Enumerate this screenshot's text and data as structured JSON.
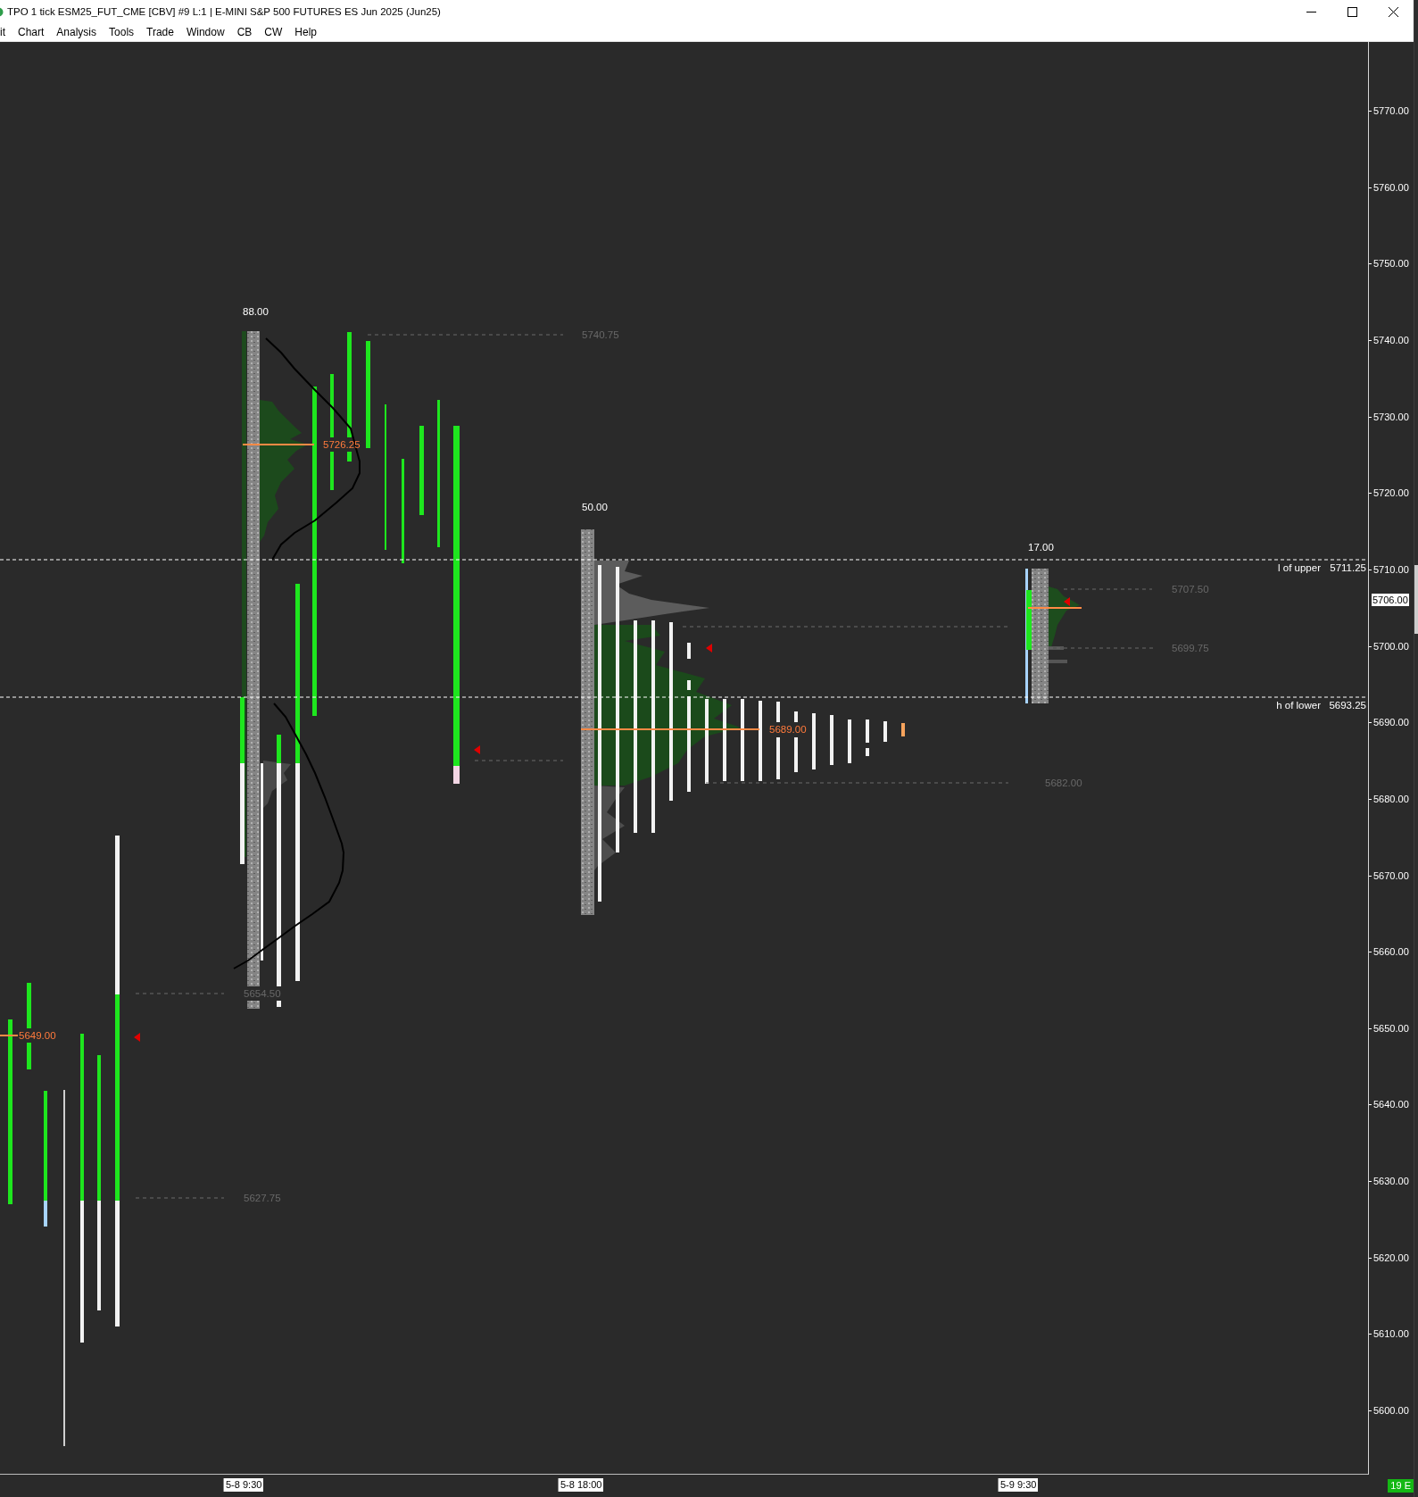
{
  "window": {
    "title": "TPO 1 tick ESM25_FUT_CME [CBV] #9 L:1 | E-MINI S&P 500 FUTURES ES Jun 2025 (Jun25)"
  },
  "menu": [
    "it",
    "Chart",
    "Analysis",
    "Tools",
    "Trade",
    "Window",
    "CB",
    "CW",
    "Help"
  ],
  "chart": {
    "sessions": [
      {
        "poc_label": "5649.00",
        "level_labels": [
          "5654.50",
          "5627.75"
        ]
      },
      {
        "range_label": "88.00",
        "poc_label": "5726.25",
        "level_labels": [
          "5740.75"
        ]
      },
      {
        "range_label": "50.00",
        "poc_label": "5689.00",
        "level_labels": [
          "5682.00"
        ]
      },
      {
        "range_label": "17.00",
        "level_labels": [
          "5707.50",
          "5699.75"
        ]
      }
    ],
    "range_lines": [
      {
        "label": "l of upper",
        "value": "5711.25"
      },
      {
        "label": "h of lower",
        "value": "5693.25"
      }
    ],
    "price_axis": {
      "labels": [
        "5770.00",
        "5760.00",
        "5750.00",
        "5740.00",
        "5730.00",
        "5720.00",
        "5710.00",
        "5700.00",
        "5690.00",
        "5680.00",
        "5670.00",
        "5660.00",
        "5650.00",
        "5640.00",
        "5630.00",
        "5620.00",
        "5610.00",
        "5600.00"
      ],
      "current_price": "5706.00"
    },
    "time_axis": {
      "labels": [
        "5-8 9:30",
        "5-8 18:00",
        "5-9 9:30"
      ],
      "badge": "19 E"
    }
  }
}
